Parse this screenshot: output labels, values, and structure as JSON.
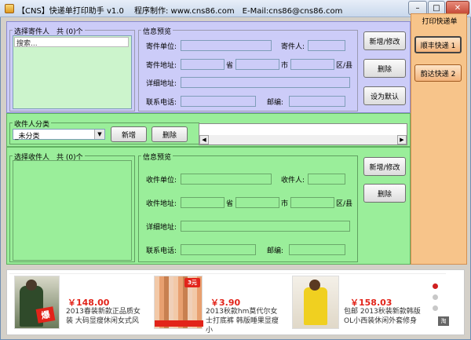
{
  "window": {
    "title": "【CNS】快递单打印助手 v1.0　 程序制作: www.cns86.com　E-Mail:cns86@cns86.com",
    "minimize": "–",
    "maximize": "□",
    "close": "✕"
  },
  "sender": {
    "list_label": "选择寄件人　共 (0)个",
    "search_placeholder": "搜索...",
    "preview_label": "信息预览",
    "company_label": "寄件单位:",
    "person_label": "寄件人:",
    "address_label": "寄件地址:",
    "province_unit": "省",
    "city_unit": "市",
    "district_unit": "区/县",
    "detail_label": "详细地址:",
    "phone_label": "联系电话:",
    "zip_label": "邮编:",
    "btn_add_edit": "新增/修改",
    "btn_delete": "删除",
    "btn_default": "设为默认"
  },
  "category": {
    "label": "收件人分类",
    "selected": "_未分类",
    "btn_add": "新增",
    "btn_delete": "删除"
  },
  "receiver": {
    "list_label": "选择收件人　共 (0)个",
    "preview_label": "信息预览",
    "company_label": "收件单位:",
    "person_label": "收件人:",
    "address_label": "收件地址:",
    "province_unit": "省",
    "city_unit": "市",
    "district_unit": "区/县",
    "detail_label": "详细地址:",
    "phone_label": "联系电话:",
    "zip_label": "邮编:",
    "btn_add_edit": "新增/修改",
    "btn_delete": "删除"
  },
  "side": {
    "title": "打印快递单",
    "items": [
      "顺丰快递 1",
      "韵达快递 2"
    ]
  },
  "ads": [
    {
      "price": "￥148.00",
      "desc": "2013春装新款正品质女装 大码显瘦休闲女式风",
      "img_badge": "爆"
    },
    {
      "price": "￥3.90",
      "desc": "2013秋款hm莫代尔女士打底裤 韩版睡果显瘦小",
      "img_badge": "3元"
    },
    {
      "price": "￥158.03",
      "desc": "包邮 2013秋装新款韩版OL小西装休闲外套修身",
      "img_badge": ""
    }
  ],
  "colors": {
    "sender_bg": "#ccccf8",
    "receiver_bg": "#9aee9a",
    "side_bg": "#f7c48a",
    "price": "#e2241a"
  }
}
